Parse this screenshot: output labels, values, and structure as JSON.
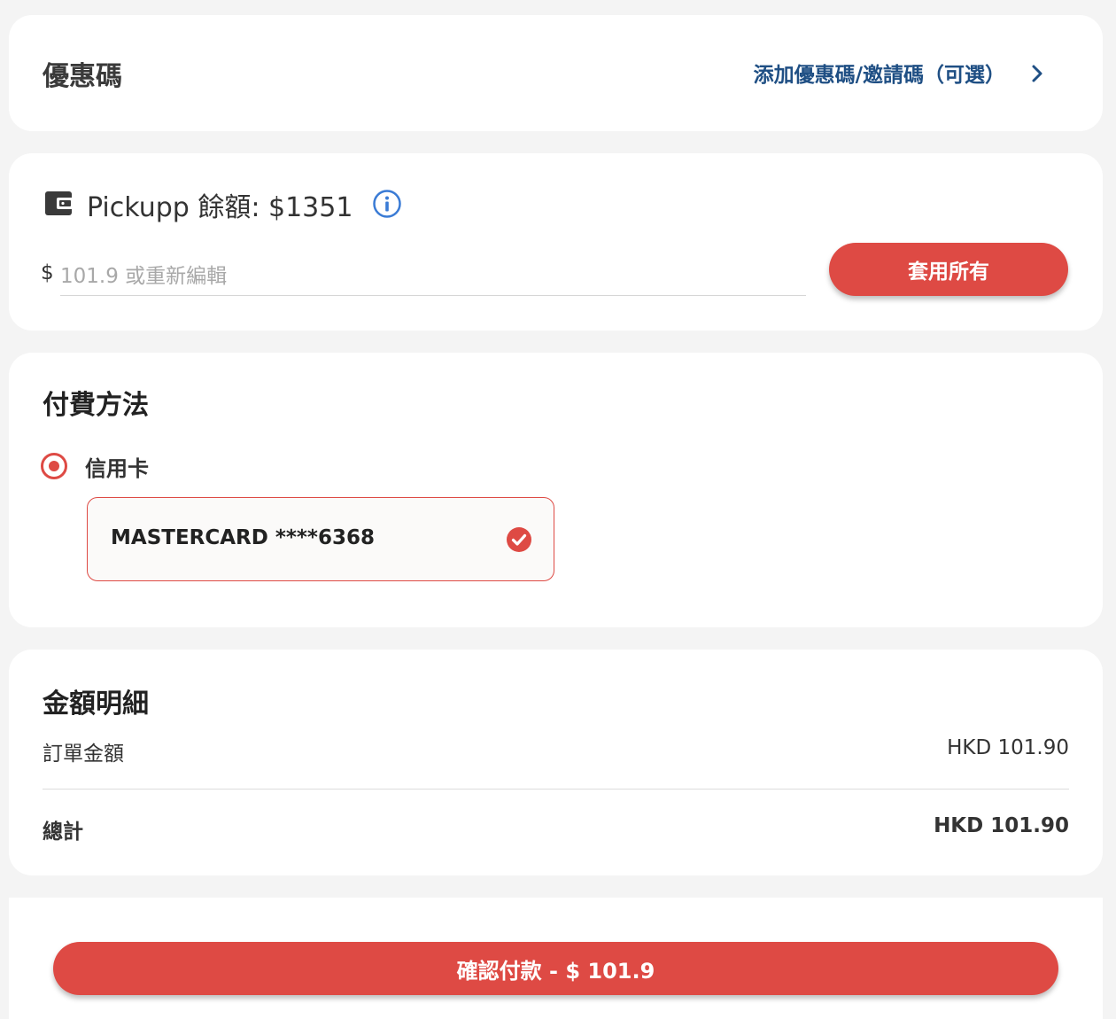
{
  "colors": {
    "accent": "#de4a44",
    "link": "#1f4f84",
    "info": "#3a7bd5",
    "background": "#f4f4f4"
  },
  "promo": {
    "title": "優惠碼",
    "link_label": "添加優惠碼/邀請碼（可選）",
    "chevron_icon": "chevron-right-icon"
  },
  "balance": {
    "icon": "wallet-icon",
    "label": "Pickupp 餘額: $1351",
    "info_icon": "info-icon",
    "currency_symbol": "$",
    "input_placeholder": "101.9 或重新編輯",
    "input_value": "",
    "apply_all_label": "套用所有"
  },
  "payment": {
    "title": "付費方法",
    "selected_method": "信用卡",
    "card_label": "MASTERCARD ****6368",
    "selected_icon": "check-circle-icon"
  },
  "details": {
    "title": "金額明細",
    "rows": [
      {
        "label": "訂單金額",
        "value": "HKD 101.90"
      },
      {
        "label": "總計",
        "value": "HKD 101.90"
      }
    ]
  },
  "confirm": {
    "label": "確認付款 - $ 101.9"
  }
}
